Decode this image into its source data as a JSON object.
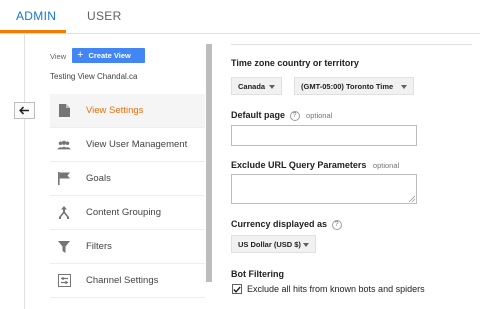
{
  "tabs": [
    {
      "label": "ADMIN",
      "active": true
    },
    {
      "label": "USER",
      "active": false
    }
  ],
  "left": {
    "view_label": "View",
    "create_view_label": "Create View",
    "view_name": "Testing View Chandal.ca",
    "nav": [
      {
        "label": "View Settings",
        "icon": "document-icon",
        "active": true
      },
      {
        "label": "View User Management",
        "icon": "people-icon",
        "active": false
      },
      {
        "label": "Goals",
        "icon": "flag-icon",
        "active": false
      },
      {
        "label": "Content Grouping",
        "icon": "grouping-icon",
        "active": false
      },
      {
        "label": "Filters",
        "icon": "funnel-icon",
        "active": false
      },
      {
        "label": "Channel Settings",
        "icon": "channel-settings-icon",
        "active": false
      }
    ]
  },
  "settings": {
    "timezone_heading": "Time zone country or territory",
    "timezone_country": "Canada",
    "timezone_value": "(GMT-05:00) Toronto Time",
    "default_page_heading": "Default page",
    "default_page_optional": "optional",
    "default_page_value": "",
    "exclude_heading": "Exclude URL Query Parameters",
    "exclude_optional": "optional",
    "exclude_value": "",
    "currency_heading": "Currency displayed as",
    "currency_value": "US Dollar (USD $)",
    "bot_heading": "Bot Filtering",
    "bot_label": "Exclude all hits from known bots and spiders",
    "bot_checked": true
  },
  "colors": {
    "accent_blue": "#1976d2",
    "accent_orange": "#f57c00",
    "button_blue": "#4285f4"
  }
}
